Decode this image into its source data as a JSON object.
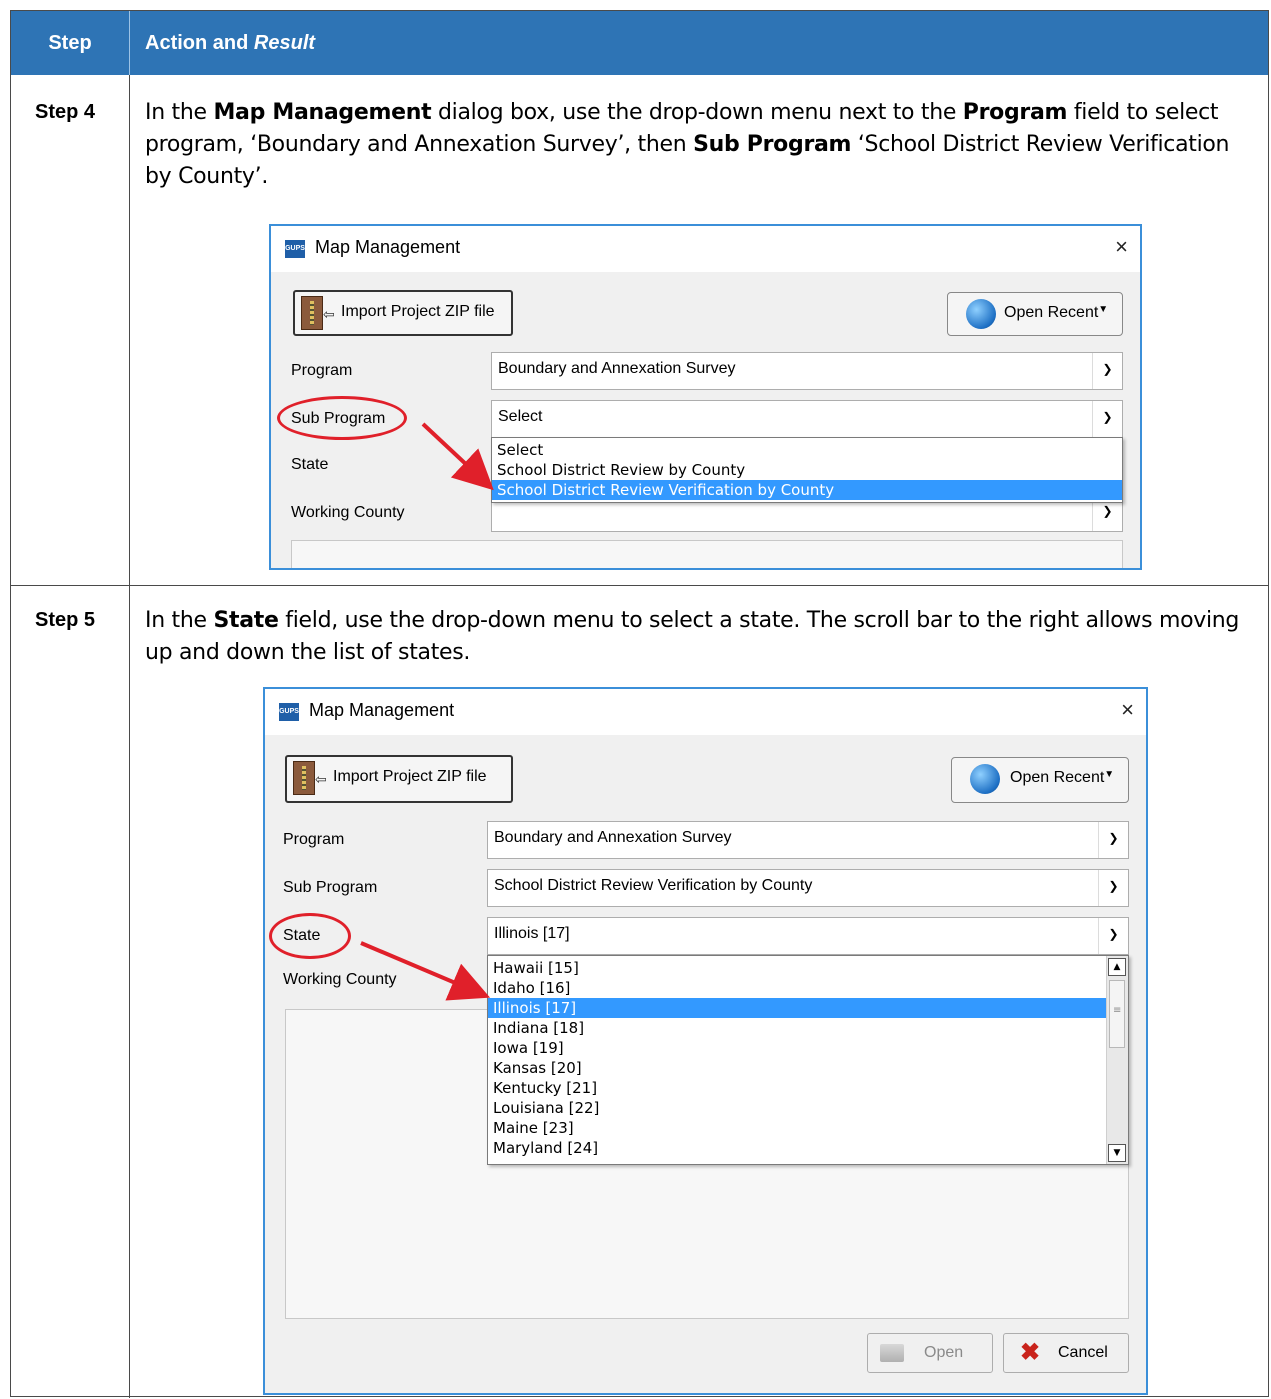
{
  "table": {
    "header_step": "Step",
    "header_action": "Action and",
    "header_result": "Result"
  },
  "step4": {
    "label": "Step 4",
    "text_p1": "In the ",
    "text_b1": "Map Management",
    "text_p2": " dialog box, use the drop-down menu next to the ",
    "text_b2": "Program",
    "text_p3": " field to select program, ‘Boundary and Annexation Survey’, then ",
    "text_b3": "Sub Program",
    "text_p4": " ‘School District Review Verification by County’.",
    "dialog": {
      "title": "Map Management",
      "close": "×",
      "import_label": "Import Project ZIP file",
      "open_recent_label": "Open Recent",
      "program_label": "Program",
      "program_value": "Boundary and Annexation Survey",
      "subprogram_label": "Sub Program",
      "subprogram_value": "Select",
      "state_label": "State",
      "working_county_label": "Working County",
      "dropdown_items": [
        "Select",
        "School District Review by County",
        "School District Review Verification by County"
      ],
      "dropdown_selected": 2
    }
  },
  "step5": {
    "label": "Step 5",
    "text_p1": "In the ",
    "text_b1": "State",
    "text_p2": " field, use the drop-down menu to select a state. The scroll bar to the right allows moving up and down the list of states.",
    "dialog": {
      "title": "Map Management",
      "close": "×",
      "import_label": "Import Project ZIP file",
      "open_recent_label": "Open Recent",
      "program_label": "Program",
      "program_value": "Boundary and Annexation Survey",
      "subprogram_label": "Sub Program",
      "subprogram_value": "School District Review Verification by County",
      "state_label": "State",
      "state_value": "Illinois [17]",
      "working_county_label": "Working County",
      "dropdown_items": [
        "Hawaii [15]",
        "Idaho [16]",
        "Illinois [17]",
        "Indiana [18]",
        "Iowa [19]",
        "Kansas [20]",
        "Kentucky [21]",
        "Louisiana [22]",
        "Maine [23]",
        "Maryland [24]"
      ],
      "dropdown_selected": 2,
      "open_button": "Open",
      "cancel_button": "Cancel"
    }
  },
  "colors": {
    "header_bg": "#2e74b5",
    "highlight": "#e0202a",
    "selection": "#3399ff"
  }
}
